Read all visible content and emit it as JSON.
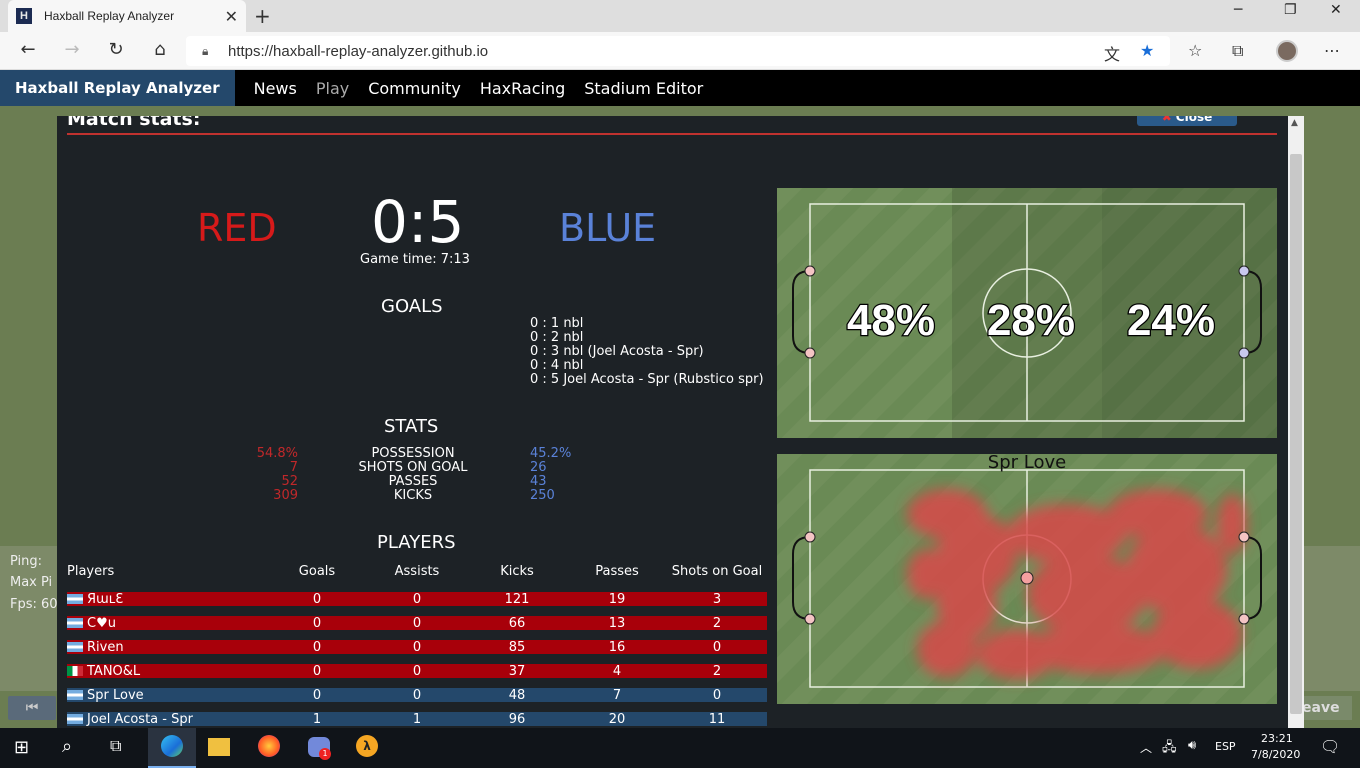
{
  "browser": {
    "tab_title": "Haxball Replay Analyzer",
    "tab_icon": "H",
    "url": "https://haxball-replay-analyzer.github.io"
  },
  "nav": {
    "brand": "Haxball Replay Analyzer",
    "links": [
      "News",
      "Play",
      "Community",
      "HaxRacing",
      "Stadium Editor"
    ]
  },
  "background": {
    "ping": "Ping:",
    "maxping": "Max Pi",
    "fps": "Fps: 60",
    "leave": "eave"
  },
  "modal": {
    "title": "Match stats:",
    "close": "Close",
    "red_team": "RED",
    "blue_team": "BLUE",
    "score": "0:5",
    "game_time": "Game time: 7:13",
    "goals_title": "GOALS",
    "goals": [
      "0 : 1 nbl",
      "0 : 2 nbl",
      "0 : 3 nbl (Joel Acosta - Spr)",
      "0 : 4 nbl",
      "0 : 5 Joel Acosta - Spr (Rubstico spr)"
    ],
    "stats_title": "STATS",
    "stats": [
      {
        "label": "POSSESSION",
        "red": "54.8%",
        "blue": "45.2%"
      },
      {
        "label": "SHOTS ON GOAL",
        "red": "7",
        "blue": "26"
      },
      {
        "label": "PASSES",
        "red": "52",
        "blue": "43"
      },
      {
        "label": "KICKS",
        "red": "309",
        "blue": "250"
      }
    ],
    "players_title": "PLAYERS",
    "players_headers": [
      "Players",
      "Goals",
      "Assists",
      "Kicks",
      "Passes",
      "Shots on Goal"
    ],
    "players": [
      {
        "name": "ЯɯʟƐ",
        "team": "red",
        "flag": "ar",
        "goals": "0",
        "assists": "0",
        "kicks": "121",
        "passes": "19",
        "shots": "3"
      },
      {
        "name": "C♥u",
        "team": "red",
        "flag": "ar",
        "goals": "0",
        "assists": "0",
        "kicks": "66",
        "passes": "13",
        "shots": "2"
      },
      {
        "name": "Riven",
        "team": "red",
        "flag": "ar",
        "goals": "0",
        "assists": "0",
        "kicks": "85",
        "passes": "16",
        "shots": "0"
      },
      {
        "name": "TANO&L",
        "team": "red",
        "flag": "it",
        "goals": "0",
        "assists": "0",
        "kicks": "37",
        "passes": "4",
        "shots": "2"
      },
      {
        "name": "Spr Love",
        "team": "blue",
        "flag": "ar",
        "goals": "0",
        "assists": "0",
        "kicks": "48",
        "passes": "7",
        "shots": "0"
      },
      {
        "name": "Joel Acosta - Spr",
        "team": "blue",
        "flag": "ar",
        "goals": "1",
        "assists": "1",
        "kicks": "96",
        "passes": "20",
        "shots": "11"
      }
    ],
    "zones": [
      "48%",
      "28%",
      "24%"
    ],
    "heatmap_player": "Spr Love"
  },
  "taskbar": {
    "lang": "ESP",
    "time": "23:21",
    "date": "7/8/2020",
    "notif_badge": "1"
  },
  "colors": {
    "red_team": "#d61a1a",
    "blue_team": "#5a82d8",
    "modal_bg": "#1d2226",
    "field": "#6a8a55"
  }
}
